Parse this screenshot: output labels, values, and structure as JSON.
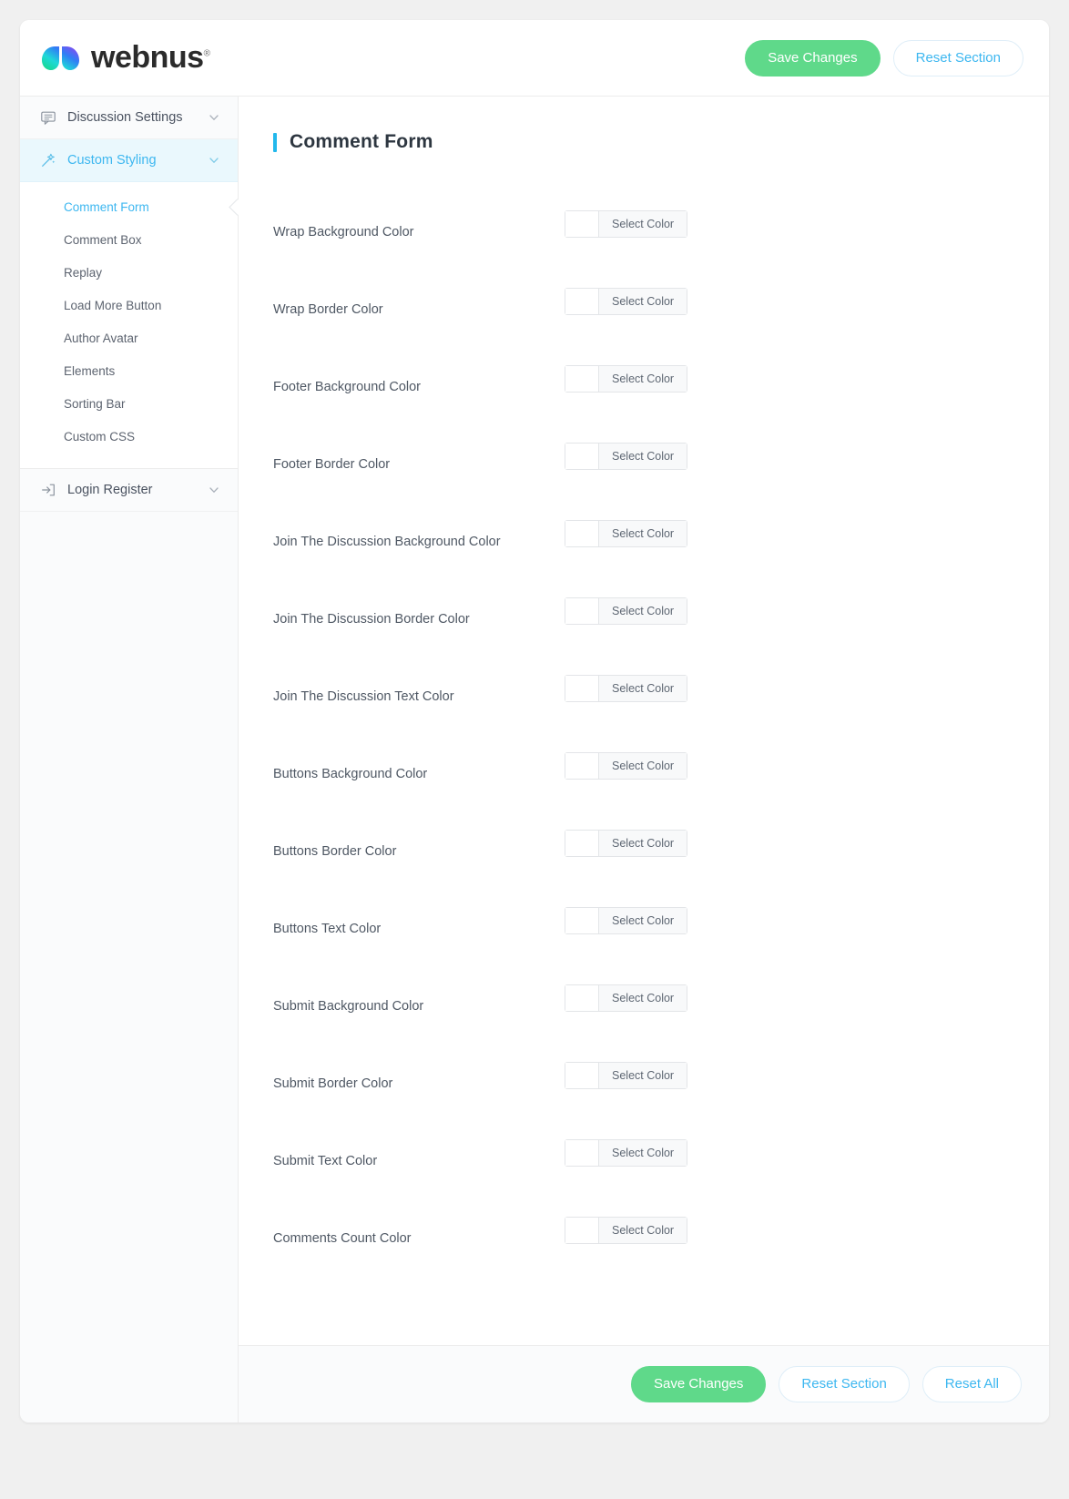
{
  "header": {
    "brand_name": "webnus",
    "brand_trademark": "®",
    "logo_icon": "webnus-gradient-mark",
    "save_label": "Save Changes",
    "reset_section_label": "Reset Section"
  },
  "sidebar": {
    "groups": [
      {
        "label": "Discussion Settings",
        "icon": "comment-icon",
        "active": false,
        "chevron": "chevron-down-icon",
        "items": []
      },
      {
        "label": "Custom Styling",
        "icon": "magic-wand-icon",
        "active": true,
        "chevron": "chevron-down-icon",
        "items": [
          {
            "label": "Comment Form",
            "active": true
          },
          {
            "label": "Comment Box",
            "active": false
          },
          {
            "label": "Replay",
            "active": false
          },
          {
            "label": "Load More Button",
            "active": false
          },
          {
            "label": "Author Avatar",
            "active": false
          },
          {
            "label": "Elements",
            "active": false
          },
          {
            "label": "Sorting Bar",
            "active": false
          },
          {
            "label": "Custom CSS",
            "active": false
          }
        ]
      },
      {
        "label": "Login Register",
        "icon": "login-arrow-icon",
        "active": false,
        "chevron": "chevron-down-icon",
        "items": []
      }
    ]
  },
  "main": {
    "section_title": "Comment Form",
    "select_color_label": "Select Color",
    "fields": [
      {
        "label": "Wrap Background Color",
        "value": ""
      },
      {
        "label": "Wrap Border Color",
        "value": ""
      },
      {
        "label": "Footer Background Color",
        "value": ""
      },
      {
        "label": "Footer Border Color",
        "value": ""
      },
      {
        "label": "Join The Discussion Background Color",
        "value": ""
      },
      {
        "label": "Join The Discussion Border Color",
        "value": ""
      },
      {
        "label": "Join The Discussion Text Color",
        "value": ""
      },
      {
        "label": "Buttons Background Color",
        "value": ""
      },
      {
        "label": "Buttons Border Color",
        "value": ""
      },
      {
        "label": "Buttons Text Color",
        "value": ""
      },
      {
        "label": "Submit Background Color",
        "value": ""
      },
      {
        "label": "Submit Border Color",
        "value": ""
      },
      {
        "label": "Submit Text Color",
        "value": ""
      },
      {
        "label": "Comments Count Color",
        "value": ""
      }
    ]
  },
  "footer": {
    "save_label": "Save Changes",
    "reset_section_label": "Reset Section",
    "reset_all_label": "Reset All"
  },
  "colors": {
    "accent_blue": "#3db7f0",
    "title_bar_blue": "#22b8ec",
    "save_green": "#5fd98a",
    "active_nav_bg": "#eaf8fd",
    "page_bg": "#f0f0f0",
    "label_text": "#4f5864"
  }
}
